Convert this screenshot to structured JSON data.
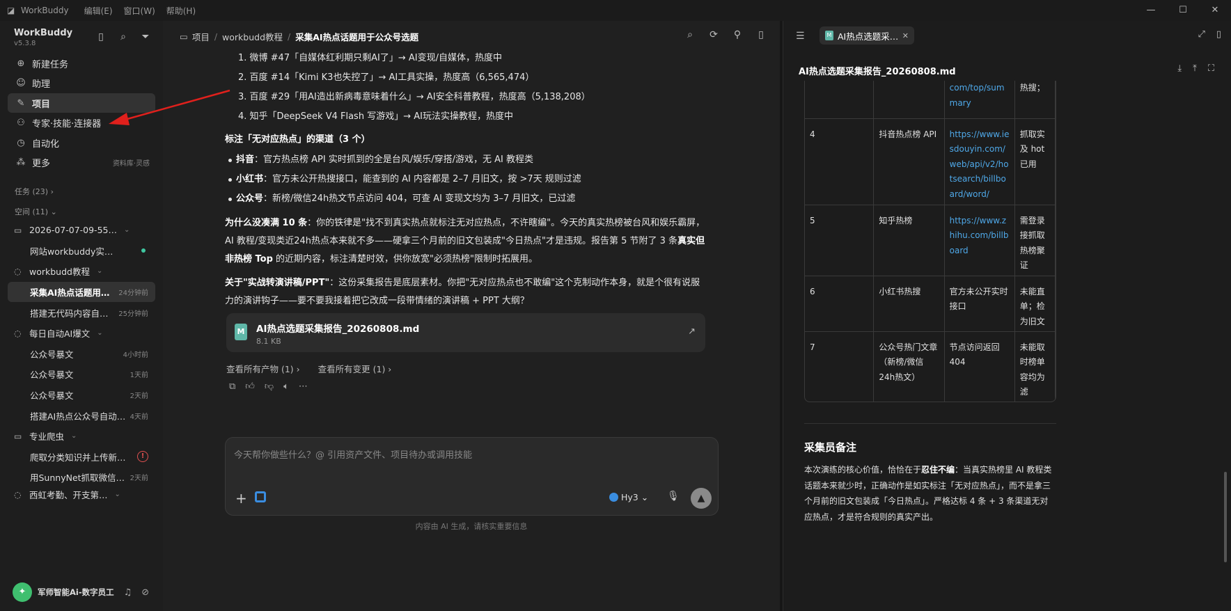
{
  "titlebar": {
    "app_name": "WorkBuddy",
    "menus": [
      "编辑(E)",
      "窗口(W)",
      "帮助(H)"
    ]
  },
  "sidebar": {
    "brand": "WorkBuddy",
    "version": "v5.3.8",
    "nav": [
      {
        "label": "新建任务",
        "icon": "plus-circle-icon"
      },
      {
        "label": "助理",
        "icon": "assistant-icon"
      },
      {
        "label": "项目",
        "icon": "project-icon",
        "active": true
      },
      {
        "label": "专家·技能·连接器",
        "icon": "expert-icon"
      },
      {
        "label": "自动化",
        "icon": "clock-icon"
      },
      {
        "label": "更多",
        "icon": "grid-icon",
        "right": "资料库·灵感"
      }
    ],
    "tasks_section": "任务 (23)",
    "spaces_section": "空间 (11)",
    "tree": [
      {
        "type": "group",
        "label": "2026-07-07-09-55…"
      },
      {
        "type": "child",
        "label": "网站workbuddy实…",
        "status": "green"
      },
      {
        "type": "group",
        "label": "workbudd教程"
      },
      {
        "type": "child",
        "label": "采集AI热点话题用…",
        "time": "24分钟前",
        "selected": true
      },
      {
        "type": "child",
        "label": "搭建无代码内容自…",
        "time": "25分钟前"
      },
      {
        "type": "group",
        "label": "每日自动AI爆文"
      },
      {
        "type": "child",
        "label": "公众号暴文",
        "time": "4小时前"
      },
      {
        "type": "child",
        "label": "公众号暴文",
        "time": "1天前"
      },
      {
        "type": "child",
        "label": "公众号暴文",
        "time": "2天前"
      },
      {
        "type": "child",
        "label": "搭建AI热点公众号自动…",
        "time": "4天前"
      },
      {
        "type": "group",
        "label": "专业爬虫"
      },
      {
        "type": "child",
        "label": "爬取分类知识并上传新…",
        "status": "error"
      },
      {
        "type": "child",
        "label": "用SunnyNet抓取微信…",
        "time": "2天前"
      },
      {
        "type": "group",
        "label": "西虹考勤、开支第…"
      }
    ],
    "user": "军师智能Ai-数字员工"
  },
  "main": {
    "breadcrumb": [
      "项目",
      "workbudd教程",
      "采集AI热点话题用于公众号选题"
    ],
    "numbered": [
      "1. 微博 #47「自媒体红利期只剩AI了」→ AI变现/自媒体，热度中",
      "2. 百度 #14「Kimi K3也失控了」→ AI工具实操，热度高（6,565,474）",
      "3. 百度 #29「用AI造出新病毒意味着什么」→ AI安全科普教程，热度高（5,138,208）",
      "4. 知乎「DeepSeek V4 Flash 写游戏」→ AI玩法实操教程，热度中"
    ],
    "channels_heading": "标注「无对应热点」的渠道（3 个）",
    "channels": [
      {
        "name": "抖音",
        "text": "：官方热点榜 API 实时抓到的全是台风/娱乐/穿搭/游戏，无 AI 教程类"
      },
      {
        "name": "小红书",
        "text": "：官方未公开热搜接口，能查到的 AI 内容都是 2–7 月旧文，按 >7天 规则过滤"
      },
      {
        "name": "公众号",
        "text": "：新榜/微信24h热文节点访问 404，可查 AI 变现文均为 3–7 月旧文，已过滤"
      }
    ],
    "why_bold": "为什么没凑满 10 条",
    "why_text": "：你的铁律是\"找不到真实热点就标注无对应热点，不许瞎编\"。今天的真实热榜被台风和娱乐霸屏，AI 教程/变现类近24h热点本来就不多——硬拿三个月前的旧文包装成\"今日热点\"才是违规。报告第 5 节附了 3 条",
    "why_bold2": "真实但非热榜 Top",
    "why_text2": " 的近期内容，标注清楚时效，供你放宽\"必须热榜\"限制时拓展用。",
    "about_bold": "关于\"实战转演讲稿/PPT\"",
    "about_text": "：这份采集报告是底层素材。你把\"无对应热点也不敢编\"这个克制动作本身，就是个很有说服力的演讲钩子——要不要我接着把它改成一段带情绪的演讲稿 + PPT 大纲？",
    "file": {
      "name": "AI热点选题采集报告_20260808.md",
      "size": "8.1 KB"
    },
    "links": [
      "查看所有产物 (1) ›",
      "查看所有变更 (1) ›"
    ],
    "composer_placeholder": "今天帮你做些什么？@ 引用资产文件、项目待办或调用技能",
    "model": "Hy3",
    "footnote": "内容由 AI 生成，请核实重要信息"
  },
  "panel": {
    "tab": "AI热点选题采…",
    "doc_title": "AI热点选题采集报告_20260808.md",
    "table_rows": [
      {
        "n": "",
        "name": "",
        "url": "com/top/summary",
        "note": "热搜；"
      },
      {
        "n": "4",
        "name": "抖音热点榜 API",
        "url": "https://www.iesdouyin.com/web/api/v2/hotsearch/billboard/word/",
        "note": "抓取实及 hot已用"
      },
      {
        "n": "5",
        "name": "知乎热榜",
        "url": "https://www.zhihu.com/billboard",
        "note": "需登录接抓取热榜聚证"
      },
      {
        "n": "6",
        "name": "小红书热搜",
        "url": "官方未公开实时接口",
        "note": "未能直单；检为旧文"
      },
      {
        "n": "7",
        "name": "公众号热门文章（新榜/微信24h热文）",
        "url": "节点访问返回 404",
        "note": "未能取时榜单容均为滤"
      }
    ],
    "notes_title": "采集员备注",
    "notes_text_a": "本次演练的核心价值，恰恰在于",
    "notes_bold": "忍住不编",
    "notes_text_b": "：当真实热榜里 AI 教程类话题本来就少时，正确动作是如实标注「无对应热点」，而不是拿三个月前的旧文包装成「今日热点」。严格达标 4 条 + 3 条渠道无对应热点，才是符合规则的真实产出。"
  },
  "colors": {
    "accent_link": "#4fa8e8",
    "annotation_arrow": "#e0201c",
    "status_green": "#3fc6a0",
    "error_red": "#e05050"
  }
}
